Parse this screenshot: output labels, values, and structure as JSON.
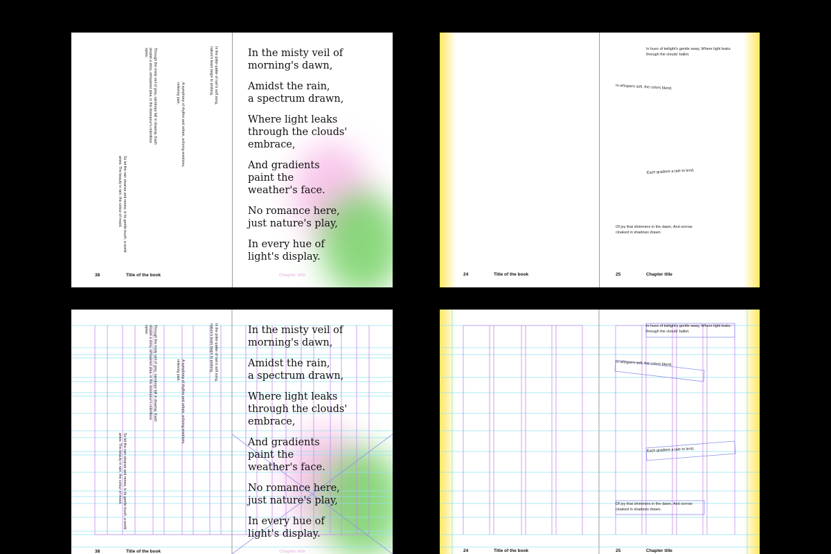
{
  "colors": {
    "background": "#000000",
    "page": "#ffffff",
    "accent_pink": "#f3b6e3",
    "accent_green": "#7fd06d",
    "accent_yellow": "#ffe86b",
    "guide_cyan": "#8fe3f0",
    "guide_magenta": "#c48be6"
  },
  "poem": {
    "stanzas": [
      "In the misty veil of\nmorning's dawn,",
      "Amidst the rain,\na spectrum drawn,",
      "Where light leaks\nthrough the clouds'\nembrace,",
      "And gradients\npaint the\nweather's face.",
      "No romance here,\njust nature's play,",
      "In every hue of\nlight's display."
    ]
  },
  "vertical_texts": {
    "v1": "In the pitter-patter of rain's soft song, nature's tears begin to prolong.",
    "v2": "Through the misty veil of grey, raindrops fall in disarray. Each droplet a story, whispered plea, in the downpour's relentless spree.",
    "v3": "A symphony of rhythm and refrain, echoing emotions, relieving pain.",
    "v4": "So let the rain cleanse and renew, in its gentle touch, a world anew. The beauty in rain, the colour of mood."
  },
  "spread_a": {
    "page_left": "38",
    "title_left": "Title of the book",
    "title_right": "Chapter title"
  },
  "spread_b": {
    "page_left": "24",
    "title_left": "Title of the book",
    "page_right": "25",
    "title_right": "Chapter title",
    "lines": [
      "In hues of twilight's gentle sway, Where light leaks through the clouds' ballet.",
      "In whispers soft, the colors blend,",
      "Each gradient a tale to lend,",
      "Of joy that shimmers in the dawn, And sorrow cloaked in shadows drawn."
    ]
  }
}
